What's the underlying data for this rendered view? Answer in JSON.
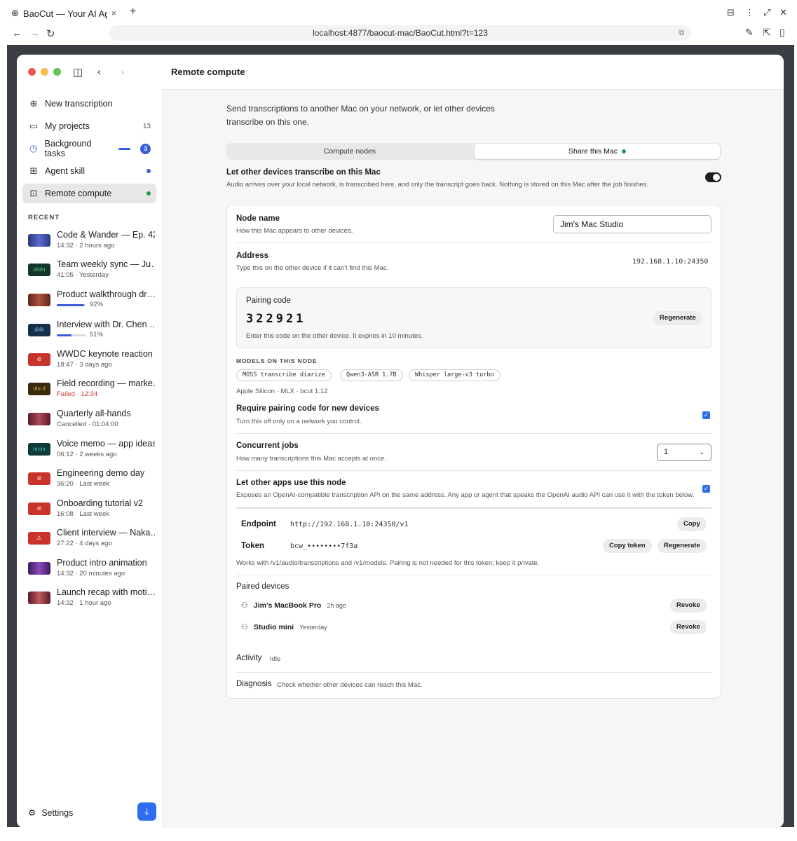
{
  "browser": {
    "tab_title": "BaoCut — Your AI Ager",
    "tab_close": "×",
    "new_tab": "+",
    "url": "localhost:4877/baocut-mac/BaoCut.html?t=123"
  },
  "sidebar": {
    "nav": [
      {
        "label": "New transcription",
        "icon": "plus-circle-icon"
      },
      {
        "label": "My projects",
        "count": "13",
        "icon": "folder-icon"
      },
      {
        "label": "Background tasks",
        "badge": "3",
        "icon": "clock-icon"
      },
      {
        "label": "Agent skill",
        "icon": "grid-icon"
      },
      {
        "label": "Remote compute",
        "icon": "remote-icon"
      }
    ],
    "recent_heading": "RECENT",
    "recent": [
      {
        "title": "Code & Wander — Ep. 42…",
        "sub": "14:32 · 2 hours ago"
      },
      {
        "title": "Team weekly sync — Ju…",
        "sub": "41:05 · Yesterday"
      },
      {
        "title": "Product walkthrough dr…",
        "progress": 0.92,
        "pct": "92%"
      },
      {
        "title": "Interview with Dr. Chen …",
        "progress": 0.51,
        "pct": "51%"
      },
      {
        "title": "WWDC keynote reaction",
        "sub": "18:47 · 3 days ago"
      },
      {
        "title": "Field recording — marke…",
        "sub": "Failed · 12:34"
      },
      {
        "title": "Quarterly all-hands",
        "sub": "Cancelled · 01:04:00"
      },
      {
        "title": "Voice memo — app ideas",
        "sub": "06:12 · 2 weeks ago"
      },
      {
        "title": "Engineering demo day",
        "sub": "36:20 · Last week"
      },
      {
        "title": "Onboarding tutorial v2",
        "sub": "16:08 · Last week"
      },
      {
        "title": "Client interview — Naka…",
        "sub": "27:22 · 4 days ago"
      },
      {
        "title": "Product intro animation",
        "sub": "14:32 · 20 minutes ago"
      },
      {
        "title": "Launch recap with moti…",
        "sub": "14:32 · 1 hour ago"
      }
    ],
    "settings": "Settings"
  },
  "page": {
    "title": "Remote compute",
    "intro": "Send transcriptions to another Mac on your network, or let other devices transcribe on this one.",
    "tabs": [
      "Compute nodes",
      "Share this Mac"
    ],
    "share": {
      "label": "Let other devices transcribe on this Mac",
      "desc": "Audio arrives over your local network, is transcribed here, and only the transcript goes back. Nothing is stored on this Mac after the job finishes.",
      "enabled": true
    },
    "node_name": {
      "label": "Node name",
      "desc": "How this Mac appears to other devices.",
      "value": "Jim's Mac Studio"
    },
    "address": {
      "label": "Address",
      "desc": "Type this on the other device if it can't find this Mac.",
      "value": "192.168.1.10:24350"
    },
    "pairing": {
      "label": "Pairing code",
      "code": "322921",
      "desc": "Enter this code on the other device. It expires in 10 minutes.",
      "button": "Regenerate"
    },
    "models": {
      "heading": "MODELS ON THIS NODE",
      "items": [
        "MOSS transcribe diarize",
        "Qwen3-ASR 1.7B",
        "Whisper large-v3 turbo"
      ],
      "meta": "Apple Silicon · MLX · bcut 1.12"
    },
    "require_pairing": {
      "label": "Require pairing code for new devices",
      "desc": "Turn this off only on a network you control.",
      "checked": true
    },
    "concurrent": {
      "label": "Concurrent jobs",
      "desc": "How many transcriptions this Mac accepts at once.",
      "value": "1"
    },
    "other_apps": {
      "label": "Let other apps use this node",
      "desc": "Exposes an OpenAI-compatible transcription API on the same address. Any app or agent that speaks the OpenAI audio API can use it with the token below.",
      "checked": true
    },
    "endpoint": {
      "label": "Endpoint",
      "value": "http://192.168.1.10:24350/v1",
      "button": "Copy"
    },
    "token": {
      "label": "Token",
      "value": "bcw_••••••••7f3a",
      "copy": "Copy token",
      "regen": "Regenerate",
      "note": "Works with /v1/audio/transcriptions and /v1/models. Pairing is not needed for this token; keep it private."
    },
    "paired": {
      "heading": "Paired devices",
      "devices": [
        {
          "name": "Jim's MacBook Pro",
          "when": "2h ago",
          "button": "Revoke"
        },
        {
          "name": "Studio mini",
          "when": "Yesterday",
          "button": "Revoke"
        }
      ]
    },
    "activity": {
      "label": "Activity",
      "value": "Idle"
    },
    "diagnosis": {
      "label": "Diagnosis",
      "value": "Check whether other devices can reach this Mac."
    }
  },
  "colors": {
    "accent": "#3b5bd9",
    "green": "#1e9e4a",
    "blue_button": "#2e6cf0",
    "failed": "#d0342c"
  }
}
